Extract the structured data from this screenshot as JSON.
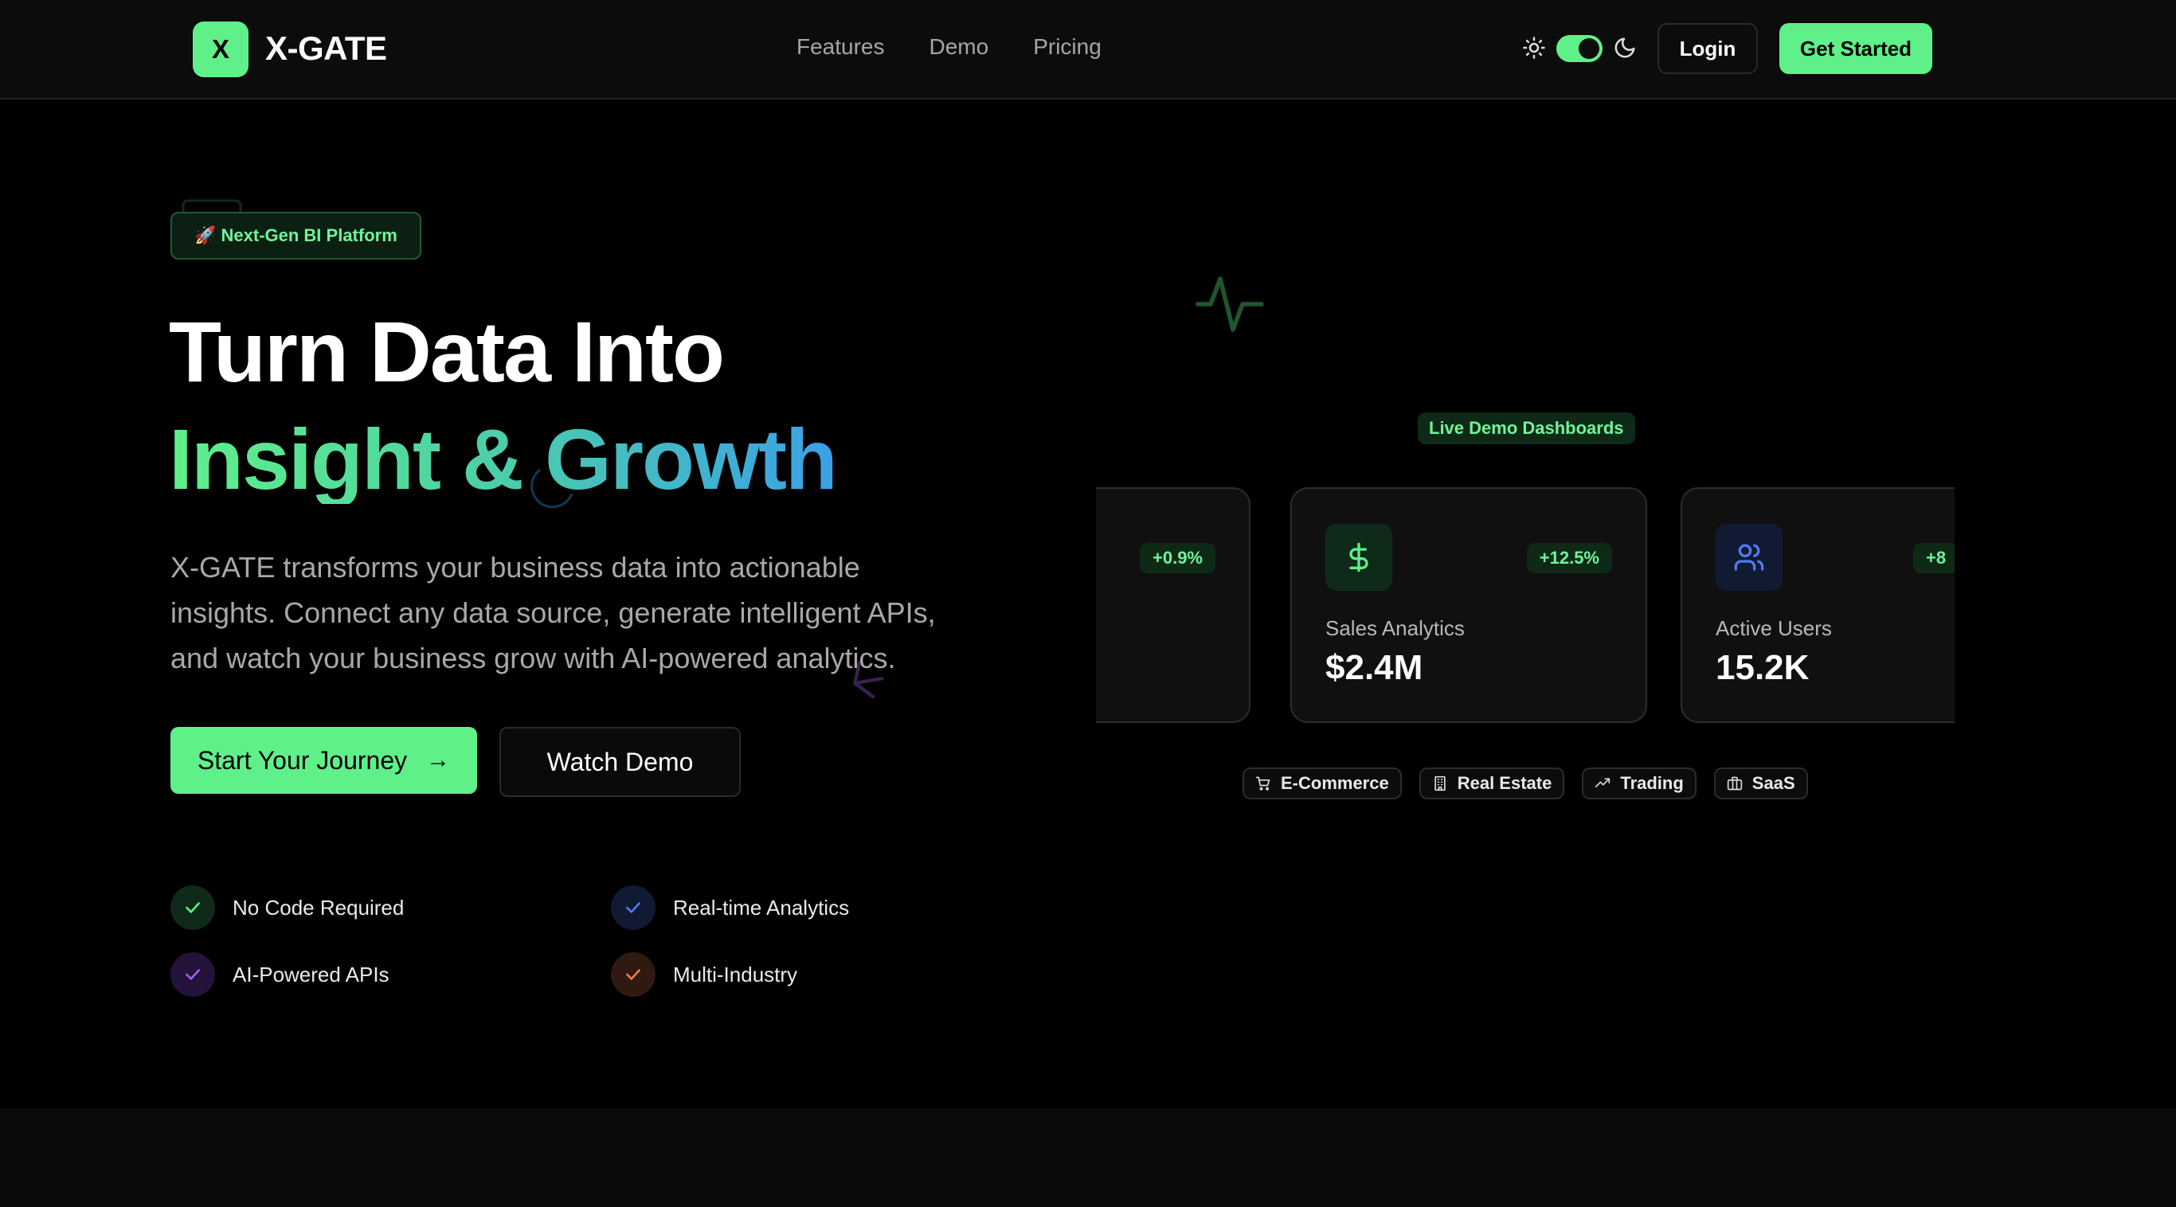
{
  "brand": {
    "logo_letter": "X",
    "name": "X-GATE",
    "accent": "#5ff08a"
  },
  "nav": {
    "items": [
      "Features",
      "Demo",
      "Pricing"
    ]
  },
  "header": {
    "theme_toggle_state": "dark",
    "login_label": "Login",
    "get_started_label": "Get Started"
  },
  "hero": {
    "badge": "🚀 Next-Gen BI Platform",
    "title_line1": "Turn Data Into",
    "title_line2": "Insight & Growth",
    "description": "X-GATE transforms your business data into actionable insights. Connect any data source, generate intelligent APIs, and watch your business grow with AI-powered analytics.",
    "primary_cta": "Start Your Journey",
    "primary_cta_icon": "arrow-right-icon",
    "secondary_cta": "Watch Demo",
    "features": [
      {
        "label": "No Code Required",
        "color": "#5ff08a",
        "bg": "#0f2a18"
      },
      {
        "label": "Real-time Analytics",
        "color": "#4f7bf0",
        "bg": "#111a33"
      },
      {
        "label": "AI-Powered APIs",
        "color": "#a55ff0",
        "bg": "#23123a"
      },
      {
        "label": "Multi-Industry",
        "color": "#f07a4f",
        "bg": "#2e1a10"
      }
    ]
  },
  "demo": {
    "badge": "Live Demo Dashboards",
    "cards": [
      {
        "change": "+0.9%",
        "label": "",
        "value": "",
        "icon": ""
      },
      {
        "change": "+12.5%",
        "label": "Sales Analytics",
        "value": "$2.4M",
        "icon": "dollar-icon"
      },
      {
        "change": "+8",
        "label": "Active Users",
        "value": "15.2K",
        "icon": "users-icon"
      }
    ],
    "tags": [
      {
        "label": "E-Commerce",
        "icon": "cart-icon"
      },
      {
        "label": "Real Estate",
        "icon": "building-icon"
      },
      {
        "label": "Trading",
        "icon": "trending-up-icon"
      },
      {
        "label": "SaaS",
        "icon": "briefcase-icon"
      }
    ]
  }
}
